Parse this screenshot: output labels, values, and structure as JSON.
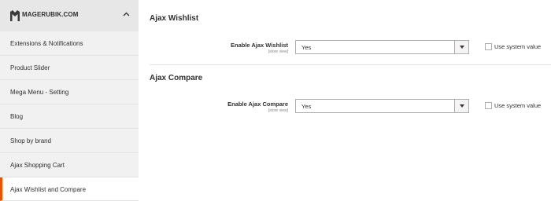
{
  "sidebar": {
    "brand": "MAGERUBIK.COM",
    "items": [
      {
        "label": "Extensions & Notifications"
      },
      {
        "label": "Product Slider"
      },
      {
        "label": "Mega Menu - Setting"
      },
      {
        "label": "Blog"
      },
      {
        "label": "Shop by brand"
      },
      {
        "label": "Ajax Shopping Cart"
      },
      {
        "label": "Ajax Wishlist and Compare"
      }
    ],
    "active_index": 6
  },
  "sections": [
    {
      "title": "Ajax Wishlist",
      "field_label": "Enable Ajax Wishlist",
      "scope": "[store view]",
      "value": "Yes",
      "system_value_label": "Use system value",
      "system_value_checked": false
    },
    {
      "title": "Ajax Compare",
      "field_label": "Enable Ajax Compare",
      "scope": "[store view]",
      "value": "Yes",
      "system_value_label": "Use system value",
      "system_value_checked": false
    }
  ],
  "colors": {
    "accent": "#eb5202",
    "sidebar_bg": "#f1f1f1",
    "sidebar_header_bg": "#e7e7e7"
  },
  "icons": [
    "magerubik-logo-icon",
    "chevron-up-icon",
    "dropdown-arrow-icon"
  ]
}
